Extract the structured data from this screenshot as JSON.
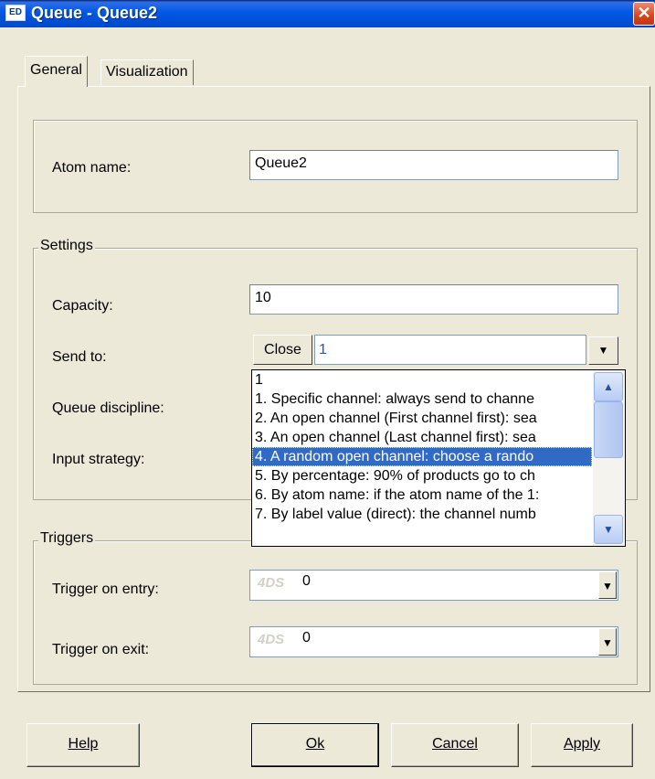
{
  "window": {
    "title": "Queue - Queue2",
    "icon_text": "ED",
    "close_glyph": "✕"
  },
  "tabs": [
    {
      "label": "General",
      "active": true
    },
    {
      "label": "Visualization",
      "active": false
    }
  ],
  "atom": {
    "label": "Atom name:",
    "value": "Queue2"
  },
  "settings": {
    "legend": "Settings",
    "capacity_label": "Capacity:",
    "capacity_value": "10",
    "send_to_label": "Send to:",
    "close_label": "Close",
    "send_to_value": "1",
    "queue_discipline_label": "Queue discipline:",
    "input_strategy_label": "Input strategy:"
  },
  "send_to_options": [
    "1",
    "1. Specific channel: always send to channe",
    "2. An open channel (First channel first): sea",
    "3. An open channel (Last channel first): sea",
    "4. A random open channel: choose a rando",
    "5. By percentage: 90% of products go to ch",
    "6. By atom name: if the atom name of the 1:",
    "7. By label value (direct): the channel numb"
  ],
  "send_to_selected_index": 4,
  "triggers": {
    "legend": "Triggers",
    "entry_label": "Trigger on entry:",
    "entry_prefix": "4DS",
    "entry_value": "0",
    "exit_label": "Trigger on exit:",
    "exit_prefix": "4DS",
    "exit_value": "0"
  },
  "buttons": {
    "help": "Help",
    "ok": "Ok",
    "cancel": "Cancel",
    "apply": "Apply"
  },
  "colors": {
    "selection": "#316ac5",
    "title_bar": "#0058e6",
    "dialog_bg": "#ece9d8"
  }
}
